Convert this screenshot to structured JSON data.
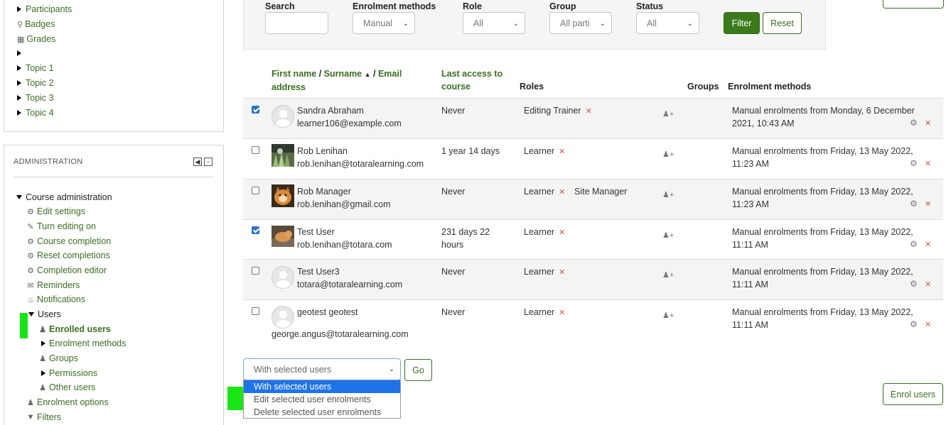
{
  "course_nav": {
    "items": [
      {
        "label": "Participants",
        "icon": "triangle-right-icon"
      },
      {
        "label": "Badges",
        "icon": "badge-icon"
      },
      {
        "label": "Grades",
        "icon": "grades-icon"
      },
      {
        "label": "",
        "icon": "triangle-right-icon"
      },
      {
        "label": "Topic 1",
        "icon": "triangle-right-icon"
      },
      {
        "label": "Topic 2",
        "icon": "triangle-right-icon"
      },
      {
        "label": "Topic 3",
        "icon": "triangle-right-icon"
      },
      {
        "label": "Topic 4",
        "icon": "triangle-right-icon"
      }
    ]
  },
  "admin": {
    "title": "ADMINISTRATION",
    "course_admin": "Course administration",
    "edit_settings": "Edit settings",
    "turn_editing_on": "Turn editing on",
    "course_completion": "Course completion",
    "reset_completions": "Reset completions",
    "completion_editor": "Completion editor",
    "reminders": "Reminders",
    "notifications": "Notifications",
    "users": "Users",
    "enrolled_users": "Enrolled users",
    "enrolment_methods": "Enrolment methods",
    "groups": "Groups",
    "permissions": "Permissions",
    "other_users": "Other users",
    "enrolment_options": "Enrolment options",
    "filters": "Filters"
  },
  "filter": {
    "search_label": "Search",
    "search_value": "",
    "enrolment_methods_label": "Enrolment methods",
    "enrolment_methods_value": "Manual",
    "role_label": "Role",
    "role_value": "All",
    "group_label": "Group",
    "group_value": "All parti",
    "status_label": "Status",
    "status_value": "All",
    "filter_button": "Filter",
    "reset_button": "Reset"
  },
  "table": {
    "headers": {
      "first_name": "First name",
      "sep1": " / ",
      "surname": "Surname",
      "sep2": " / ",
      "email": "Email",
      "address": "address",
      "last_access_1": "Last access to",
      "last_access_2": "course",
      "roles": "Roles",
      "groups": "Groups",
      "enrolment_methods": "Enrolment methods"
    },
    "rows": [
      {
        "checked": true,
        "name": "Sandra Abraham",
        "email": "learner106@example.com",
        "last_access_1": "Never",
        "last_access_2": "",
        "role1": "Editing Trainer",
        "role2": "",
        "enrol_1": "Manual enrolments from Monday, 6 December",
        "enrol_2": "2021, 10:43 AM"
      },
      {
        "checked": false,
        "name": "Rob Lenihan",
        "email": "rob.lenihan@totaralearning.com",
        "last_access_1": "1 year 14 days",
        "last_access_2": "",
        "role1": "Learner",
        "role2": "",
        "enrol_1": "Manual enrolments from Friday, 13 May 2022,",
        "enrol_2": "11:23 AM"
      },
      {
        "checked": false,
        "name": "Rob Manager",
        "email": "rob.lenihan@gmail.com",
        "last_access_1": "Never",
        "last_access_2": "",
        "role1": "Learner",
        "role2": "Site Manager",
        "enrol_1": "Manual enrolments from Friday, 13 May 2022,",
        "enrol_2": "11:23 AM"
      },
      {
        "checked": true,
        "name": "Test User",
        "email": "rob.lenihan@totara.com",
        "last_access_1": "231 days 22",
        "last_access_2": "hours",
        "role1": "Learner",
        "role2": "",
        "enrol_1": "Manual enrolments from Friday, 13 May 2022,",
        "enrol_2": "11:11 AM"
      },
      {
        "checked": false,
        "name": "Test User3",
        "email": "totara@totaralearning.com",
        "last_access_1": "Never",
        "last_access_2": "",
        "role1": "Learner",
        "role2": "",
        "enrol_1": "Manual enrolments from Friday, 13 May 2022,",
        "enrol_2": "11:11 AM"
      },
      {
        "checked": false,
        "name": "geotest geotest",
        "email": "george.angus@totaralearning.com",
        "last_access_1": "Never",
        "last_access_2": "",
        "role1": "Learner",
        "role2": "",
        "enrol_1": "Manual enrolments from Friday, 13 May 2022,",
        "enrol_2": "11:11 AM"
      }
    ]
  },
  "bulk": {
    "select_value": "With selected users",
    "go_button": "Go",
    "options": [
      "With selected users",
      "Edit selected user enrolments",
      "Delete selected user enrolments"
    ],
    "enrol_users_button": "Enrol users"
  },
  "colors": {
    "accent": "#3a7a1c",
    "highlight": "#18e614",
    "remove": "#d9534f",
    "selected_option": "#1e73e8"
  }
}
